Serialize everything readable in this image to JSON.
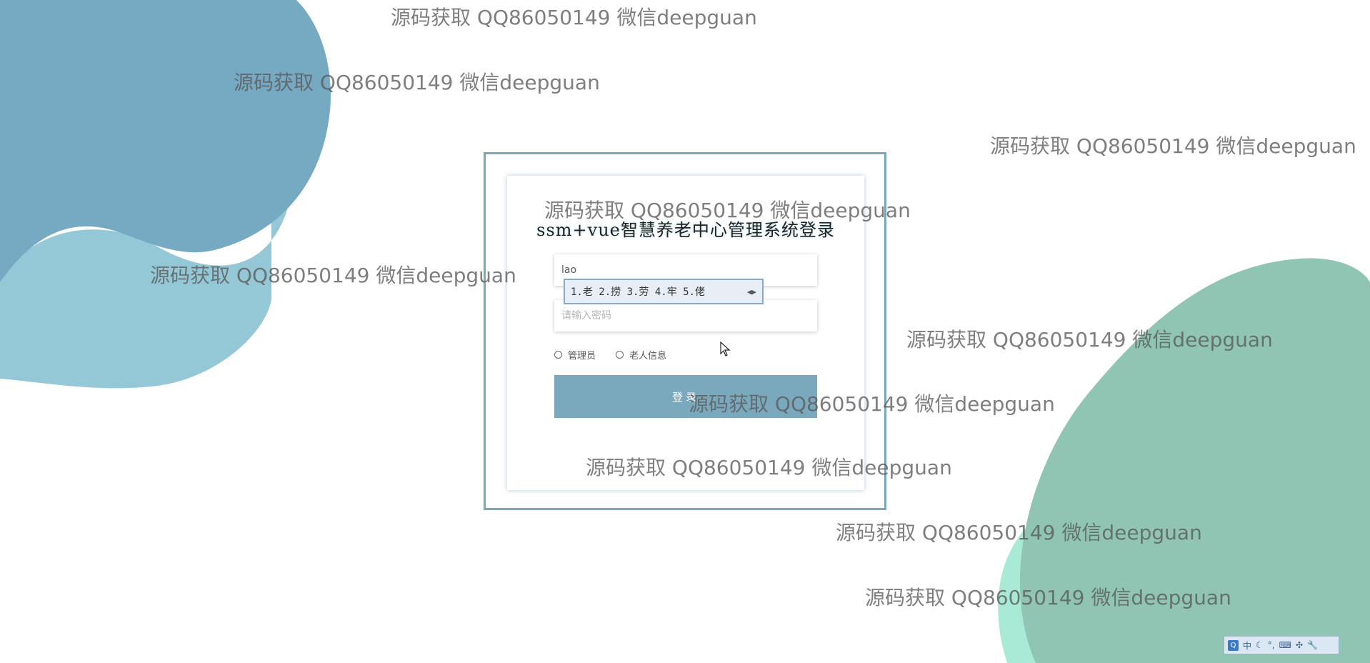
{
  "watermark_text": "源码获取 QQ86050149 微信deepguan",
  "colors": {
    "blob_blue_dark": "#76a9c2",
    "blob_blue_light": "#95c8d6",
    "blob_green": "#8fc5b2",
    "blob_mint": "#a8ead6",
    "accent": "#7aa9be"
  },
  "login": {
    "title": "ssm+vue智慧养老中心管理系统登录",
    "username_value": "lao",
    "password_placeholder": "请输入密码",
    "roles": [
      "管理员",
      "老人信息"
    ],
    "submit_label": "登录"
  },
  "ime": {
    "candidates": "1.老 2.捞 3.劳 4.牢 5.佬",
    "arrows": "◀▶"
  },
  "ime_toolbar": {
    "logo": "Q",
    "mode": "中",
    "icons": [
      "moon-icon",
      "punctuation-icon",
      "keyboard-icon",
      "tools-icon",
      "wrench-icon"
    ]
  }
}
